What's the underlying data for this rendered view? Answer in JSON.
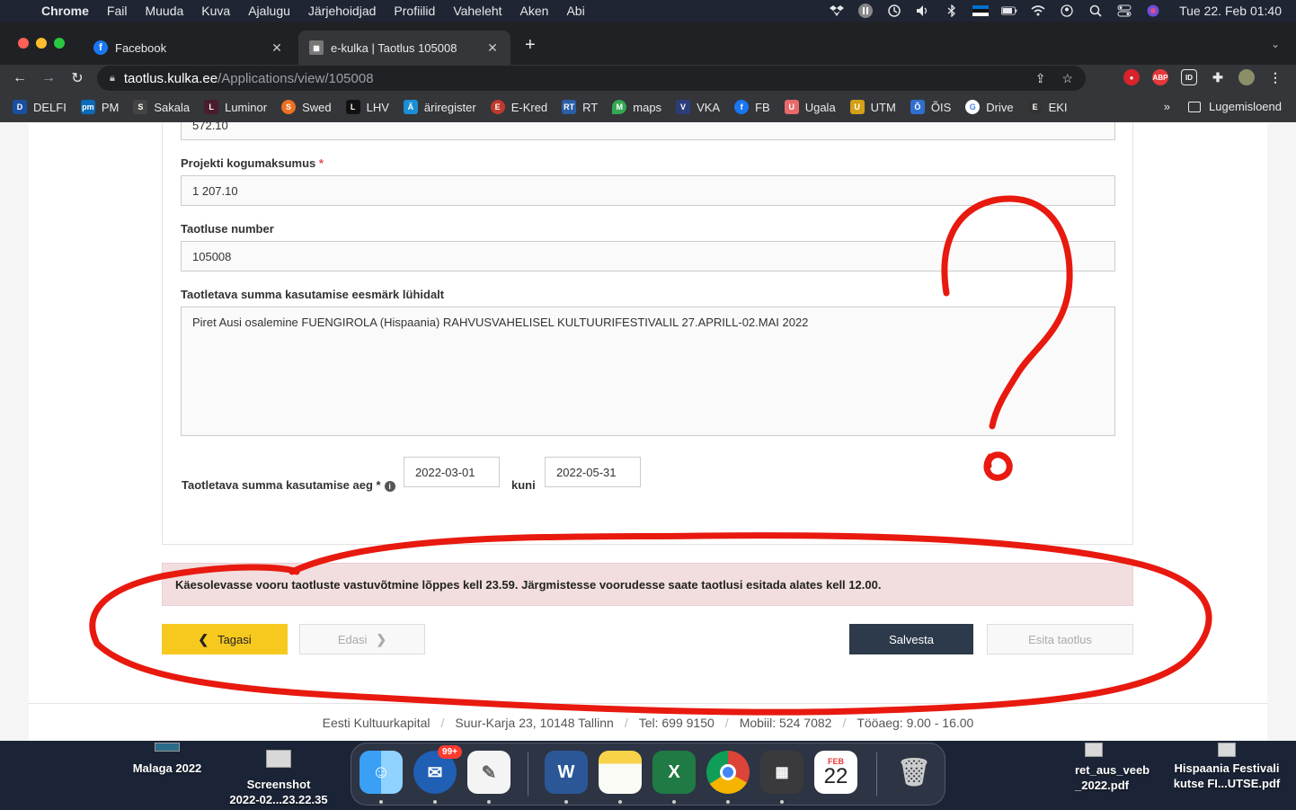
{
  "menubar": {
    "app": "Chrome",
    "items": [
      "Fail",
      "Muuda",
      "Kuva",
      "Ajalugu",
      "Järjehoidjad",
      "Profiilid",
      "Vaheleht",
      "Aken",
      "Abi"
    ],
    "clock": "Tue 22. Feb  01:40"
  },
  "tabs": [
    {
      "label": "Facebook"
    },
    {
      "label": "e-kulka | Taotlus 105008"
    }
  ],
  "address": {
    "host": "taotlus.kulka.ee",
    "path": "/Applications/view/105008"
  },
  "bookmarks": [
    {
      "label": "DELFI",
      "badge": "D",
      "color": "#1a4fa0"
    },
    {
      "label": "PM",
      "badge": "pm",
      "color": "#0a6cb8"
    },
    {
      "label": "Sakala",
      "badge": "S",
      "color": "#444444"
    },
    {
      "label": "Luminor",
      "badge": "L",
      "color": "#4a1c2c"
    },
    {
      "label": "Swed",
      "badge": "S",
      "color": "#ee7023"
    },
    {
      "label": "LHV",
      "badge": "L",
      "color": "#111111"
    },
    {
      "label": "äriregister",
      "badge": "Ä",
      "color": "#1b8fd6"
    },
    {
      "label": "E-Kred",
      "badge": "E",
      "color": "#c0392b"
    },
    {
      "label": "RT",
      "badge": "RT",
      "color": "#2a5fa8"
    },
    {
      "label": "maps",
      "badge": "M",
      "color": "#34a853"
    },
    {
      "label": "VKA",
      "badge": "V",
      "color": "#2c3e7a"
    },
    {
      "label": "FB",
      "badge": "f",
      "color": "#1877f2"
    },
    {
      "label": "Ugala",
      "badge": "U",
      "color": "#e96a6a"
    },
    {
      "label": "UTM",
      "badge": "U",
      "color": "#d4a017"
    },
    {
      "label": "ÕIS",
      "badge": "Õ",
      "color": "#2f6fd0"
    },
    {
      "label": "Drive",
      "badge": "G",
      "color": "#4285f4"
    },
    {
      "label": "EKI",
      "badge": "E",
      "color": "#333333"
    }
  ],
  "bookmarks_more": "»",
  "reading_list": "Lugemisloend",
  "form": {
    "top_value": "572.10",
    "total_label": "Projekti kogumaksumus",
    "total_value": "1 207.10",
    "number_label": "Taotluse number",
    "number_value": "105008",
    "purpose_label": "Taotletava summa kasutamise eesmärk lühidalt",
    "purpose_value": "Piret Ausi osalemine FUENGIROLA (Hispaania) RAHVUSVAHELISEL KULTUURIFESTIVALIL 27.APRILL-02.MAI 2022",
    "period_label": "Taotletava summa kasutamise aeg",
    "required_mark": "*",
    "info_glyph": "i",
    "date_from": "2022-03-01",
    "until_label": "kuni",
    "date_to": "2022-05-31"
  },
  "alert": "Käesolevasse vooru taotluste vastuvõtmine lõppes kell 23.59. Järgmistesse voorudesse saate taotlusi esitada alates kell 12.00.",
  "buttons": {
    "back": "Tagasi",
    "next": "Edasi",
    "save": "Salvesta",
    "submit": "Esita taotlus"
  },
  "footer": [
    "Eesti Kultuurkapital",
    "Suur-Karja 23, 10148 Tallinn",
    "Tel: 699 9150",
    "Mobiil: 524 7082",
    "Tööaeg: 9.00 - 16.00"
  ],
  "footer_separator": "/",
  "annotation_color": "#e8190f",
  "desktop": {
    "items": [
      {
        "label": "Malaga 2022"
      },
      {
        "label": "Screenshot\n2022-02...23.22.35"
      },
      {
        "label": "ret_aus_veeb\n_2022.pdf"
      },
      {
        "label": "Hispaania Festivali\nkutse FI...UTSE.pdf"
      }
    ]
  },
  "dock": {
    "mail_badge": "99+",
    "calendar_month": "FEB",
    "calendar_day": "22",
    "apps": [
      "finder",
      "thunderbird",
      "textedit",
      "word",
      "notes",
      "excel",
      "chrome",
      "calculator",
      "calendar",
      "trash"
    ]
  }
}
